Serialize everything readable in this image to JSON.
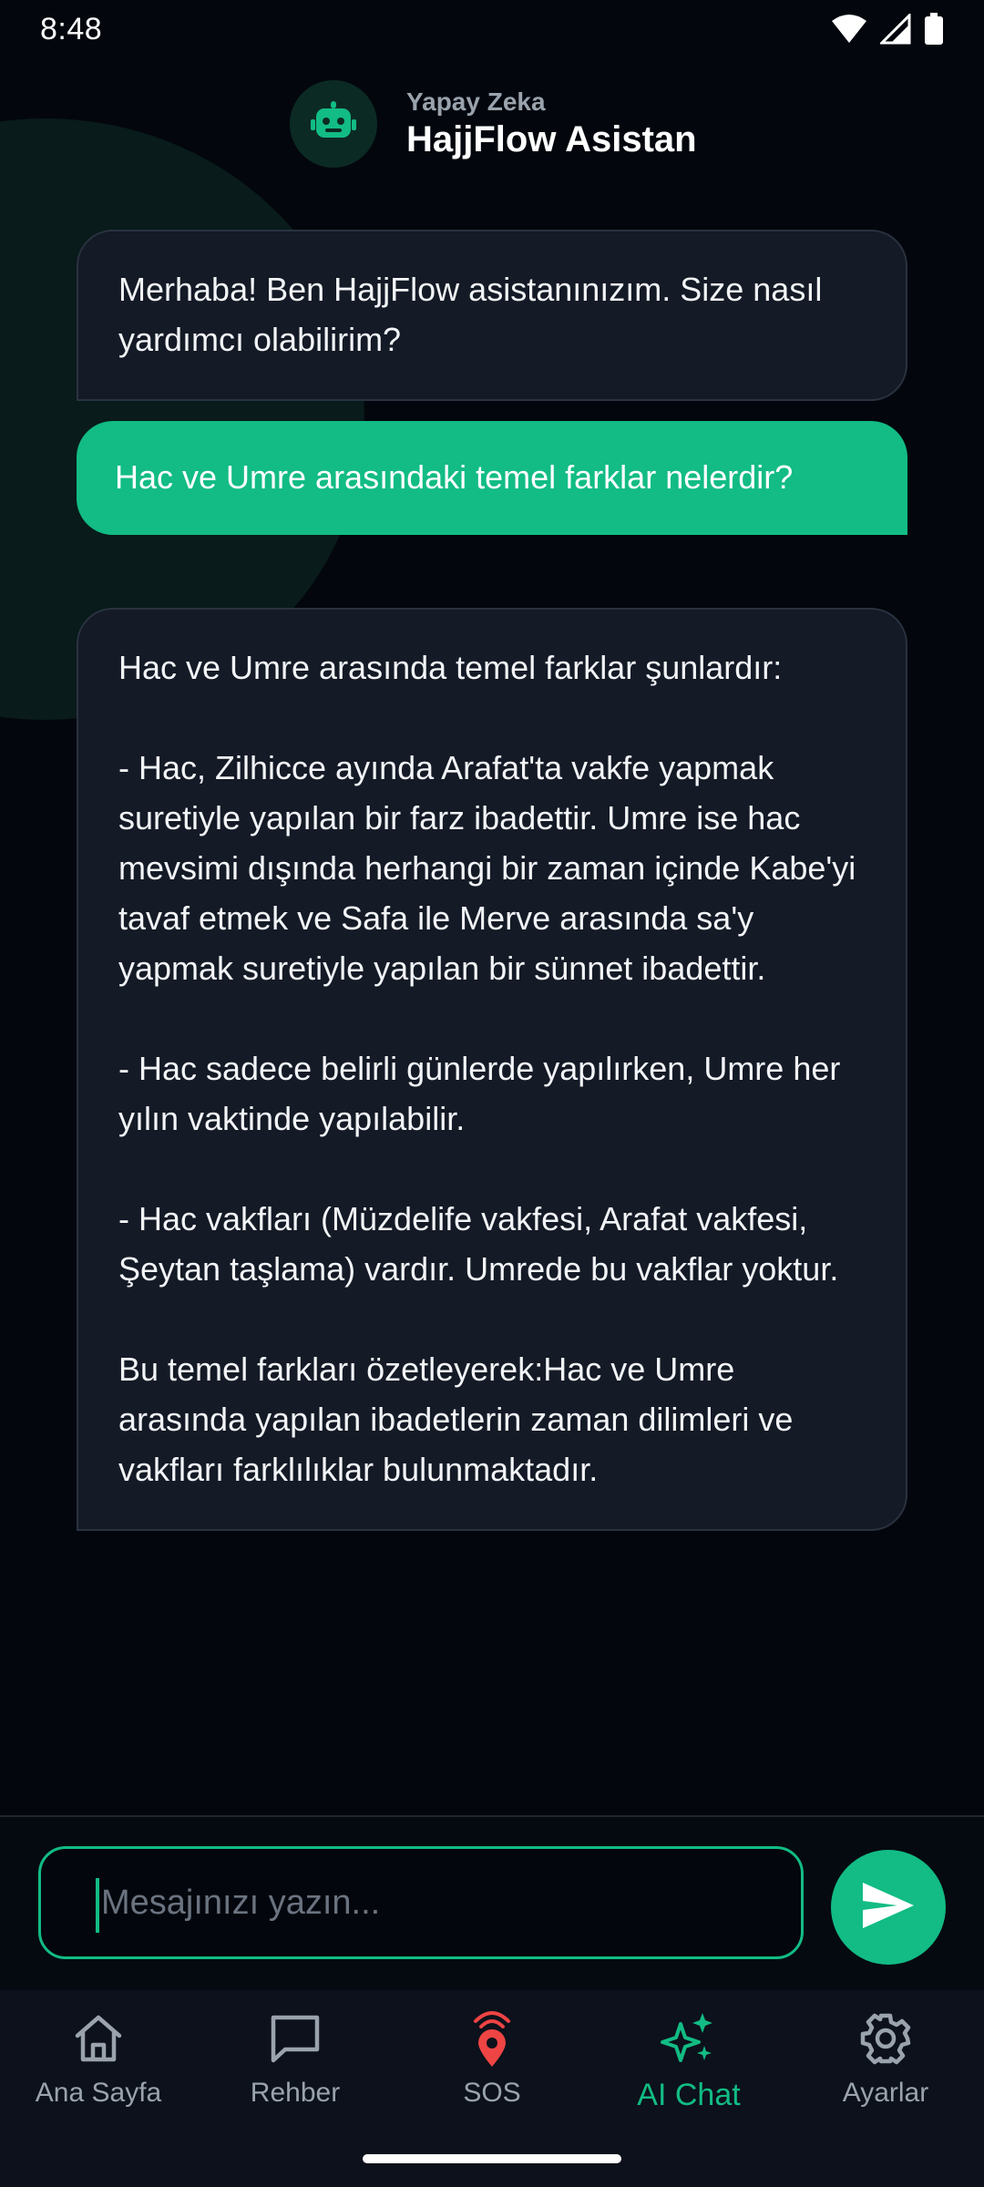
{
  "status_bar": {
    "time": "8:48",
    "icons": [
      "wifi-icon",
      "signal-icon",
      "battery-icon"
    ]
  },
  "header": {
    "subtitle": "Yapay Zeka",
    "title": "HajjFlow Asistan",
    "avatar_icon": "robot-icon"
  },
  "messages": [
    {
      "role": "bot",
      "text": "Merhaba! Ben HajjFlow asistanınızım. Size nasıl yardımcı olabilirim?"
    },
    {
      "role": "user",
      "text": "Hac ve Umre arasındaki temel farklar nelerdir?"
    },
    {
      "role": "bot",
      "text": "Hac ve Umre arasında temel farklar şunlardır:\n\n- Hac, Zilhicce ayında Arafat'ta vakfe yapmak suretiyle yapılan bir farz ibadettir. Umre ise hac mevsimi dışında herhangi bir zaman içinde Kabe'yi tavaf etmek ve Safa ile Merve arasında sa'y yapmak suretiyle yapılan bir sünnet ibadettir.\n\n- Hac sadece belirli günlerde yapılırken, Umre her yılın vaktinde yapılabilir.\n\n- Hac vakfları (Müzdelife vakfesi, Arafat vakfesi, Şeytan taşlama) vardır. Umrede bu vakflar yoktur.\n\nBu temel farkları özetleyerek:Hac ve Umre arasında yapılan ibadetlerin zaman dilimleri ve vakfları farklılıklar bulunmaktadır."
    }
  ],
  "input": {
    "placeholder": "Mesajınızı yazın...",
    "value": "",
    "send_icon": "send-icon"
  },
  "nav": {
    "items": [
      {
        "label": "Ana Sayfa",
        "icon": "home-icon",
        "active": false
      },
      {
        "label": "Rehber",
        "icon": "chat-bubble-icon",
        "active": false
      },
      {
        "label": "SOS",
        "icon": "location-broadcast-icon",
        "active": false
      },
      {
        "label": "AI Chat",
        "icon": "sparkles-icon",
        "active": true
      },
      {
        "label": "Ayarlar",
        "icon": "gear-icon",
        "active": false
      }
    ]
  },
  "colors": {
    "accent": "#12bc84",
    "background": "#03070d",
    "bot_bubble": "#141a26",
    "sos": "#ef4444"
  }
}
